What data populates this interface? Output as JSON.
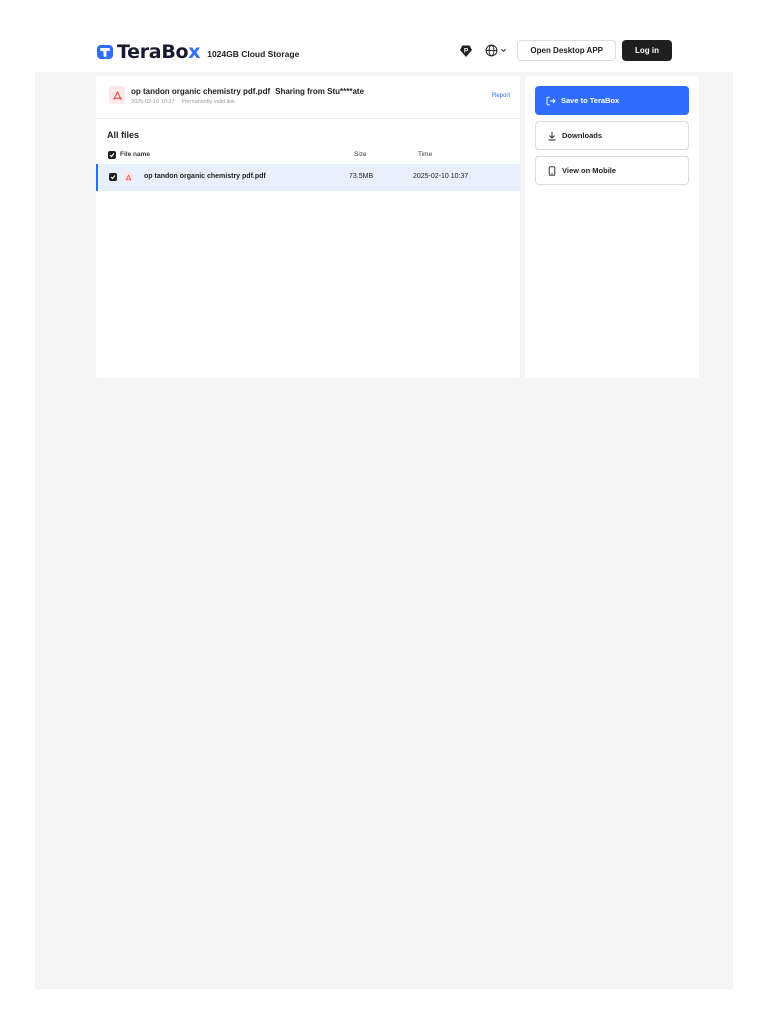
{
  "header": {
    "brand_text": "TeraBo",
    "brand_x": "x",
    "storage": "1024GB Cloud Storage",
    "open_desktop": "Open Desktop APP",
    "login": "Log in",
    "vip_icon": "diamond-p-icon",
    "lang_icon": "globe-icon"
  },
  "share": {
    "file_title": "op tandon organic chemistry pdf.pdf",
    "sharer": "Sharing from Stu****ate",
    "date": "2025-02-10 10:37",
    "validity": "Permanently valid link",
    "report": "Report"
  },
  "files": {
    "heading": "All files",
    "columns": {
      "name": "File name",
      "size": "Size",
      "time": "Time"
    },
    "rows": [
      {
        "name": "op tandon organic chemistry pdf.pdf",
        "size": "73.5MB",
        "time": "2025-02-10 10:37",
        "selected": true
      }
    ]
  },
  "actions": {
    "save": "Save to TeraBox",
    "downloads": "Downloads",
    "mobile": "View on Mobile"
  },
  "colors": {
    "accent": "#2f6dff",
    "pdf_red": "#ef4b4b",
    "selected_row": "#e8f0fd",
    "background": "#f5f5f5"
  }
}
